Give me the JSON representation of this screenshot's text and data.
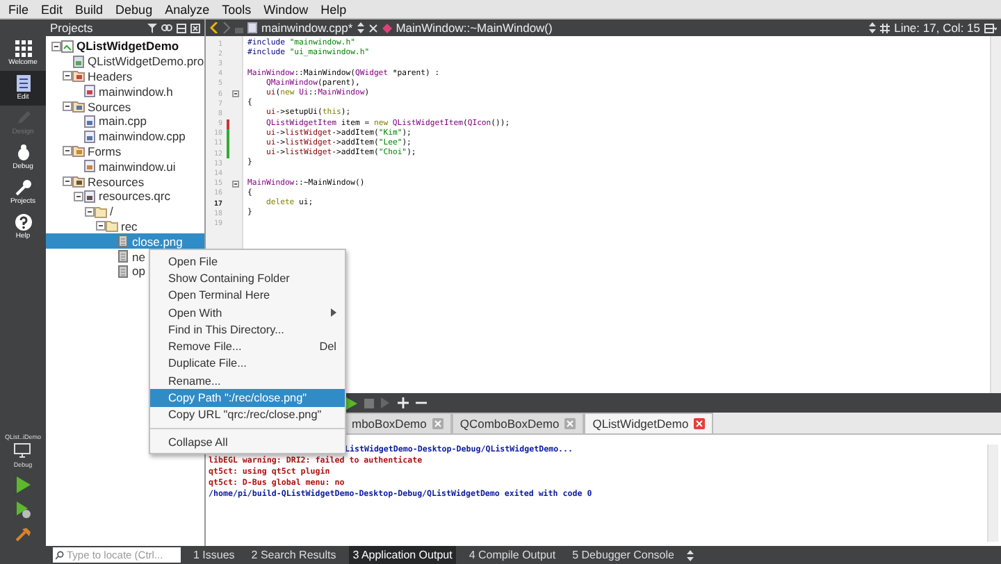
{
  "menubar": [
    "File",
    "Edit",
    "Build",
    "Debug",
    "Analyze",
    "Tools",
    "Window",
    "Help"
  ],
  "modes": [
    {
      "label": "Welcome",
      "kind": "welcome",
      "selected": false,
      "disabled": false
    },
    {
      "label": "Edit",
      "kind": "edit",
      "selected": true,
      "disabled": false
    },
    {
      "label": "Design",
      "kind": "design",
      "selected": false,
      "disabled": true
    },
    {
      "label": "Debug",
      "kind": "debug",
      "selected": false,
      "disabled": false
    },
    {
      "label": "Projects",
      "kind": "projects",
      "selected": false,
      "disabled": false
    },
    {
      "label": "Help",
      "kind": "help",
      "selected": false,
      "disabled": false
    }
  ],
  "target": {
    "project": "QList..iDemo",
    "config": "Debug"
  },
  "projects_pane": {
    "title": "Projects"
  },
  "tree": [
    {
      "label": "QListWidgetDemo",
      "kind": "project",
      "selected": false,
      "expanded": true,
      "children": [
        {
          "label": "QListWidgetDemo.pro",
          "kind": "pro",
          "selected": false
        },
        {
          "label": "Headers",
          "kind": "headers",
          "selected": false,
          "expanded": true,
          "children": [
            {
              "label": "mainwindow.h",
              "kind": "h",
              "selected": false
            }
          ]
        },
        {
          "label": "Sources",
          "kind": "sources",
          "selected": false,
          "expanded": true,
          "children": [
            {
              "label": "main.cpp",
              "kind": "cpp",
              "selected": false
            },
            {
              "label": "mainwindow.cpp",
              "kind": "cpp",
              "selected": false
            }
          ]
        },
        {
          "label": "Forms",
          "kind": "forms",
          "selected": false,
          "expanded": true,
          "children": [
            {
              "label": "mainwindow.ui",
              "kind": "ui",
              "selected": false
            }
          ]
        },
        {
          "label": "Resources",
          "kind": "resources",
          "selected": false,
          "expanded": true,
          "children": [
            {
              "label": "resources.qrc",
              "kind": "qrc",
              "selected": false,
              "expanded": true,
              "children": [
                {
                  "label": "/",
                  "kind": "folder",
                  "selected": false,
                  "expanded": true,
                  "children": [
                    {
                      "label": "rec",
                      "kind": "folder",
                      "selected": false,
                      "expanded": true,
                      "children": [
                        {
                          "label": "close.png",
                          "kind": "png",
                          "selected": true
                        },
                        {
                          "label": "ne",
                          "kind": "png",
                          "selected": false
                        },
                        {
                          "label": "op",
                          "kind": "png",
                          "selected": false
                        }
                      ]
                    }
                  ]
                }
              ]
            }
          ]
        }
      ]
    }
  ],
  "editor": {
    "file": "mainwindow.cpp*",
    "symbol": "MainWindow::~MainWindow()",
    "position": "Line: 17, Col: 15"
  },
  "code": [
    {
      "n": "1",
      "tokens": [
        {
          "kind": "preproc",
          "text": "#include "
        },
        {
          "kind": "string",
          "text": "\"mainwindow.h\""
        }
      ]
    },
    {
      "n": "2",
      "tokens": [
        {
          "kind": "preproc",
          "text": "#include "
        },
        {
          "kind": "string",
          "text": "\"ui_mainwindow.h\""
        }
      ]
    },
    {
      "n": "3"
    },
    {
      "n": "4",
      "tokens": [
        {
          "kind": "type",
          "text": "MainWindow"
        },
        {
          "kind": "plain",
          "text": "::MainWindow("
        },
        {
          "kind": "type",
          "text": "QWidget"
        },
        {
          "kind": "plain",
          "text": " *parent) :"
        }
      ]
    },
    {
      "n": "5",
      "tokens": [
        {
          "kind": "type",
          "text": "    QMainWindow"
        },
        {
          "kind": "plain",
          "text": "(parent),"
        }
      ]
    },
    {
      "n": "6",
      "fold": true,
      "tokens": [
        {
          "kind": "field",
          "text": "    ui"
        },
        {
          "kind": "plain",
          "text": "("
        },
        {
          "kind": "keyword",
          "text": "new"
        },
        {
          "kind": "type",
          "text": " Ui"
        },
        {
          "kind": "plain",
          "text": "::"
        },
        {
          "kind": "type",
          "text": "MainWindow"
        },
        {
          "kind": "plain",
          "text": ")"
        }
      ]
    },
    {
      "n": "7",
      "tokens": [
        {
          "kind": "plain",
          "text": "{"
        }
      ]
    },
    {
      "n": "8",
      "tokens": [
        {
          "kind": "field",
          "text": "    ui"
        },
        {
          "kind": "plain",
          "text": "->setupUi("
        },
        {
          "kind": "keyword",
          "text": "this"
        },
        {
          "kind": "plain",
          "text": ");"
        }
      ]
    },
    {
      "n": "9",
      "color": "#cc3333",
      "tokens": [
        {
          "kind": "type",
          "text": "    QListWidgetItem"
        },
        {
          "kind": "plain",
          "text": " item = "
        },
        {
          "kind": "keyword",
          "text": "new"
        },
        {
          "kind": "type",
          "text": " QListWidgetItem"
        },
        {
          "kind": "plain",
          "text": "("
        },
        {
          "kind": "type",
          "text": "QIcon"
        },
        {
          "kind": "plain",
          "text": "());"
        }
      ]
    },
    {
      "n": "10",
      "color": "#33aa33",
      "tokens": [
        {
          "kind": "field",
          "text": "    ui"
        },
        {
          "kind": "plain",
          "text": "->"
        },
        {
          "kind": "field",
          "text": "listWidget"
        },
        {
          "kind": "plain",
          "text": "->addItem("
        },
        {
          "kind": "string",
          "text": "\"Kim\""
        },
        {
          "kind": "plain",
          "text": ");"
        }
      ]
    },
    {
      "n": "11",
      "color": "#33aa33",
      "tokens": [
        {
          "kind": "field",
          "text": "    ui"
        },
        {
          "kind": "plain",
          "text": "->"
        },
        {
          "kind": "field",
          "text": "listWidget"
        },
        {
          "kind": "plain",
          "text": "->addItem("
        },
        {
          "kind": "string",
          "text": "\"Lee\""
        },
        {
          "kind": "plain",
          "text": ");"
        }
      ]
    },
    {
      "n": "12",
      "color": "#33aa33",
      "tokens": [
        {
          "kind": "field",
          "text": "    ui"
        },
        {
          "kind": "plain",
          "text": "->"
        },
        {
          "kind": "field",
          "text": "listWidget"
        },
        {
          "kind": "plain",
          "text": "->addItem("
        },
        {
          "kind": "string",
          "text": "\"Choi\""
        },
        {
          "kind": "plain",
          "text": ");"
        }
      ]
    },
    {
      "n": "13",
      "tokens": [
        {
          "kind": "plain",
          "text": "}"
        }
      ]
    },
    {
      "n": "14"
    },
    {
      "n": "15",
      "fold": true,
      "tokens": [
        {
          "kind": "type",
          "text": "MainWindow"
        },
        {
          "kind": "plain",
          "text": "::~MainWindow()"
        }
      ]
    },
    {
      "n": "16",
      "tokens": [
        {
          "kind": "plain",
          "text": "{"
        }
      ]
    },
    {
      "n": "17",
      "current": true,
      "tokens": [
        {
          "kind": "keyword",
          "text": "    delete"
        },
        {
          "kind": "plain",
          "text": " ui;"
        }
      ]
    },
    {
      "n": "18",
      "tokens": [
        {
          "kind": "plain",
          "text": "}"
        }
      ]
    },
    {
      "n": "19"
    }
  ],
  "context_menu": [
    {
      "kind": "item",
      "label": "Open File",
      "selected": false
    },
    {
      "kind": "item",
      "label": "Show Containing Folder",
      "selected": false
    },
    {
      "kind": "item",
      "label": "Open Terminal Here",
      "selected": false
    },
    {
      "kind": "submenu",
      "label": "Open With",
      "selected": false
    },
    {
      "kind": "item",
      "label": "Find in This Directory...",
      "selected": false
    },
    {
      "kind": "item",
      "label": "Remove File...",
      "shortcut": "Del",
      "selected": false
    },
    {
      "kind": "item",
      "label": "Duplicate File...",
      "selected": false
    },
    {
      "kind": "item",
      "label": "Rename...",
      "selected": false
    },
    {
      "kind": "item",
      "label": "Copy Path \":/rec/close.png\"",
      "selected": true
    },
    {
      "kind": "item",
      "label": "Copy URL \"qrc:/rec/close.png\"",
      "selected": false
    },
    {
      "kind": "separator"
    },
    {
      "kind": "item",
      "label": "Collapse All",
      "selected": false
    }
  ],
  "output_tabs": [
    {
      "label": "mboBoxDemo",
      "selected": false
    },
    {
      "label": "QComboBoxDemo",
      "selected": false
    },
    {
      "label": "QListWidgetDemo",
      "selected": true
    }
  ],
  "output": [
    {
      "kind": "info",
      "text": "ListWidgetDemo-Desktop-Debug/QListWidgetDemo..."
    },
    {
      "kind": "error",
      "text": "libEGL warning: DRI2: failed to authenticate"
    },
    {
      "kind": "error",
      "text": "qt5ct: using qt5ct plugin"
    },
    {
      "kind": "error",
      "text": "qt5ct: D-Bus global menu: no"
    },
    {
      "kind": "info",
      "text": "/home/pi/build-QListWidgetDemo-Desktop-Debug/QListWidgetDemo exited with code 0"
    }
  ],
  "statusbar": {
    "search": {
      "placeholder": "Type to locate (Ctrl..."
    },
    "panes": [
      {
        "label": "1 Issues",
        "selected": false
      },
      {
        "label": "2 Search Results",
        "selected": false
      },
      {
        "label": "3 Application Output",
        "selected": true
      },
      {
        "label": "4 Compile Output",
        "selected": false
      },
      {
        "label": "5 Debugger Console",
        "selected": false
      }
    ]
  }
}
